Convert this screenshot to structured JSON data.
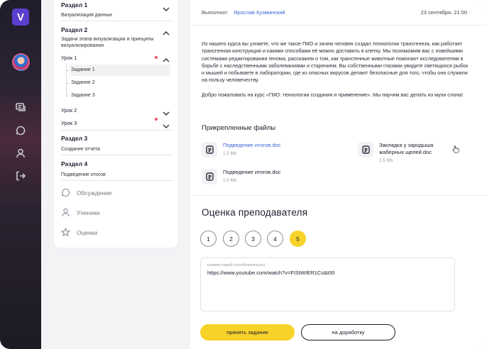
{
  "app": {
    "logo_letter": "V"
  },
  "rail": {
    "icons": [
      "chat-icon",
      "comment-icon",
      "user-icon",
      "logout-icon"
    ]
  },
  "sidebar": {
    "sections": [
      {
        "title": "Раздел 1",
        "subtitle": "Визуализация данных"
      },
      {
        "title": "Раздел 2",
        "subtitle": "Задачи этапа визуализации и принципы визуализирования"
      },
      {
        "title": "Раздел 3",
        "subtitle": "Создание отчета"
      },
      {
        "title": "Раздел 4",
        "subtitle": "Подведение итогов"
      }
    ],
    "lessons": [
      "Урок 1",
      "Урок 2",
      "Урок 3"
    ],
    "tasks": [
      "Задание 1",
      "Задание 2",
      "Задание 3"
    ],
    "links": [
      "Обсуждение",
      "Ученики",
      "Оценки"
    ]
  },
  "main": {
    "executor_label": "Выполнил:",
    "executor_name": "Ярослав Кузминский",
    "date": "23 сентября, 21:00",
    "description_p1": "Из нашего курса вы узнаете, что же такое ГМО и зачем человек создал технологии трансгенеза, как работает трансгенная конструкция и какими способами её можно доставить в клетку. Мы познакомим вас с новейшими системами редактирования генома, расскажем о том, как трансгенные животные помогают исследователям в борьбе с наследственными заболеваниями и старением. Вы собственными глазами увидите светящихся рыбок и мышей и побываете в лаборатории, где из опасных вирусов делают безопасные для того, чтобы они служили на пользу человечеству.",
    "description_p2": "Добро пожаловать на курс «ГМО: технологии создания и применение». Мы научим вас делать из мухи слона!",
    "files_heading": "Прикрепленные файлы",
    "files": [
      {
        "name": "Подведение итогов.doc",
        "size": "1.5 Mb"
      },
      {
        "name": "Закладка у зародыша жаберных щелей.doc",
        "size": "1.5 Mb"
      },
      {
        "name": "Подведение итогов.doc",
        "size": "1.5 Mb"
      }
    ],
    "grade_heading": "Оценка преподавателя",
    "grades": [
      "1",
      "2",
      "3",
      "4",
      "5"
    ],
    "selected_grade": "5",
    "comment_label": "комментарий (необязательно)",
    "comment_value": "https://www.youtube.com/watch?v=FIStWIER1Cs&t00",
    "accept_label": "принять задание",
    "rework_label": "на доработку"
  }
}
